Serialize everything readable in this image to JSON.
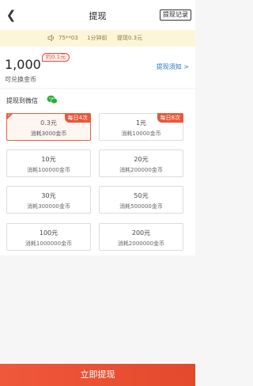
{
  "nav": {
    "title": "提现",
    "record_label": "提现记录"
  },
  "notice": {
    "user": "75**03",
    "time": "1分钟前",
    "amount": "提现0.3元"
  },
  "balance": {
    "coins": "1,000",
    "approx": "约0.1元",
    "sub": "可兑换金币",
    "notes_label": "提现须知 >"
  },
  "withdraw": {
    "heading": "提现到微信",
    "options": [
      {
        "amount": "0.3元",
        "cost": "消耗3000金币",
        "tag": "每日4次"
      },
      {
        "amount": "1元",
        "cost": "消耗10000金币",
        "tag": "每日8次"
      },
      {
        "amount": "10元",
        "cost": "消耗100000金币"
      },
      {
        "amount": "20元",
        "cost": "消耗200000金币"
      },
      {
        "amount": "30元",
        "cost": "消耗300000金币"
      },
      {
        "amount": "50元",
        "cost": "消耗500000金币"
      },
      {
        "amount": "100元",
        "cost": "消耗1000000金币"
      },
      {
        "amount": "200元",
        "cost": "消耗2000000金币"
      }
    ]
  },
  "submit_label": "立即提现",
  "colors": {
    "accent": "#e8573a",
    "link": "#2b74c9",
    "notice_bg": "#fdf5d8",
    "wechat": "#2aae3a"
  }
}
